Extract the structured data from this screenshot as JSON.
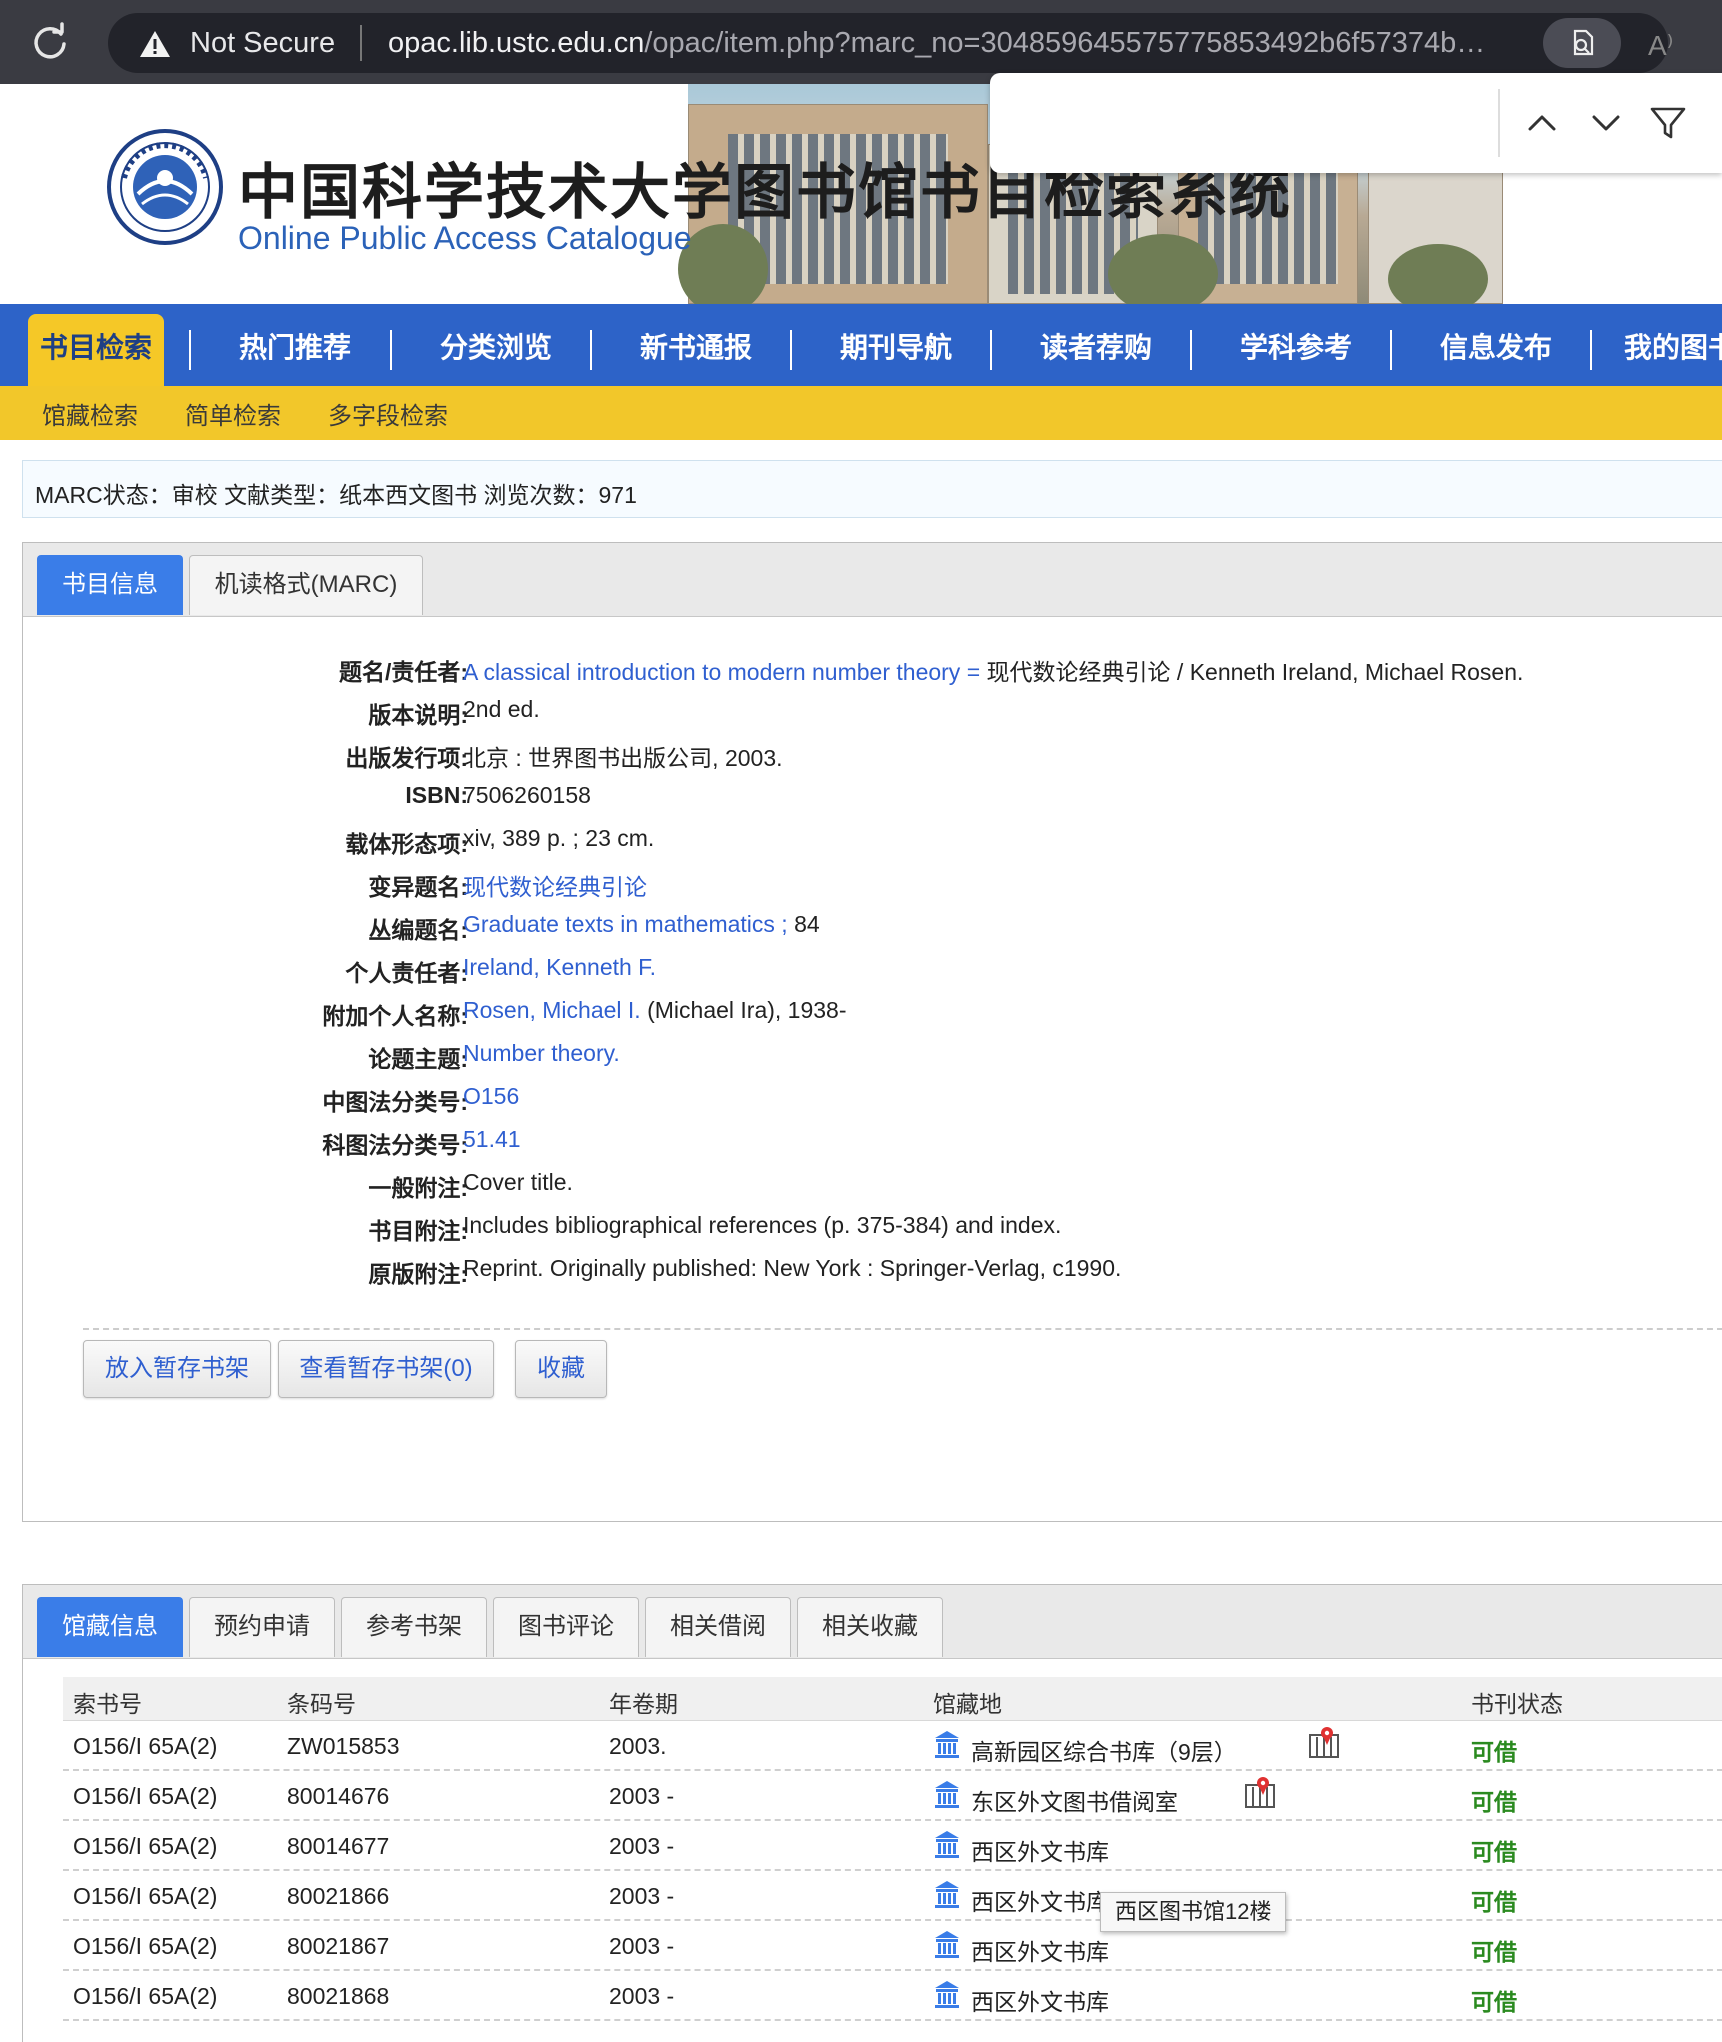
{
  "browser": {
    "security_label": "Not Secure",
    "url_domain": "opac.lib.ustc.edu.cn",
    "url_path": "/opac/item.php?marc_no=304859645575775853492b6f57374b…",
    "read_aloud": "A⁾"
  },
  "header": {
    "title": "中国科学技术大学图书馆书目检索系统",
    "subtitle": "Online Public Access Catalogue"
  },
  "nav": {
    "items": [
      "书目检索",
      "热门推荐",
      "分类浏览",
      "新书通报",
      "期刊导航",
      "读者荐购",
      "学科参考",
      "信息发布",
      "我的图书"
    ],
    "active_index": 0
  },
  "subnav": {
    "items": [
      "馆藏检索",
      "简单检索",
      "多字段检索"
    ]
  },
  "status_line": "MARC状态：审校  文献类型：纸本西文图书  浏览次数：971",
  "bib_tabs": [
    "书目信息",
    "机读格式(MARC)"
  ],
  "bib": {
    "title_label": "题名/责任者:",
    "title_link": "A classical introduction to modern number theory =",
    "title_rest": " 现代数论经典引论 / Kenneth Ireland, Michael Rosen.",
    "edition_label": "版本说明:",
    "edition": "2nd ed.",
    "publisher_label": "出版发行项:",
    "publisher": "北京 : 世界图书出版公司, 2003.",
    "isbn_label": "ISBN:",
    "isbn": "7506260158",
    "physical_label": "载体形态项:",
    "physical": "xiv, 389 p. ; 23 cm.",
    "variant_label": "变异题名:",
    "variant": "现代数论经典引论",
    "series_label": "丛编题名:",
    "series_link": "Graduate texts in mathematics ;",
    "series_rest": " 84",
    "author_label": "个人责任者:",
    "author": "Ireland, Kenneth F.",
    "added_author_label": "附加个人名称:",
    "added_author_link": "Rosen, Michael I.",
    "added_author_rest": " (Michael Ira), 1938-",
    "subject_label": "论题主题:",
    "subject": "Number theory.",
    "clc_label": "中图法分类号:",
    "clc": "O156",
    "sci_label": "科图法分类号:",
    "sci": "51.41",
    "note_label": "一般附注:",
    "note": "Cover title.",
    "bibnote_label": "书目附注:",
    "bibnote": "Includes bibliographical references (p. 375-384) and index.",
    "orig_label": "原版附注:",
    "orig": "Reprint. Originally published: New York : Springer-Verlag, c1990."
  },
  "actions": {
    "add_shelf": "放入暂存书架",
    "view_shelf": "查看暂存书架(0)",
    "favorite": "收藏"
  },
  "holding_tabs": [
    "馆藏信息",
    "预约申请",
    "参考书架",
    "图书评论",
    "相关借阅",
    "相关收藏"
  ],
  "holdings": {
    "headers": [
      "索书号",
      "条码号",
      "年卷期",
      "馆藏地",
      "书刊状态"
    ],
    "rows": [
      {
        "call_no": "O156/I 65A(2)",
        "barcode": "ZW015853",
        "year": "2003.",
        "location": "高新园区综合书库（9层）",
        "status": "可借"
      },
      {
        "call_no": "O156/I 65A(2)",
        "barcode": "80014676",
        "year": "2003 -",
        "location": "东区外文图书借阅室",
        "status": "可借"
      },
      {
        "call_no": "O156/I 65A(2)",
        "barcode": "80014677",
        "year": "2003 -",
        "location": "西区外文书库",
        "status": "可借"
      },
      {
        "call_no": "O156/I 65A(2)",
        "barcode": "80021866",
        "year": "2003 -",
        "location": "西区外文书库",
        "status": "可借"
      },
      {
        "call_no": "O156/I 65A(2)",
        "barcode": "80021867",
        "year": "2003 -",
        "location": "西区外文书库",
        "status": "可借"
      },
      {
        "call_no": "O156/I 65A(2)",
        "barcode": "80021868",
        "year": "2003 -",
        "location": "西区外文书库",
        "status": "可借"
      }
    ],
    "tooltip": "西区图书馆12楼"
  },
  "colors": {
    "nav_blue": "#2d63c8",
    "nav_yellow": "#f2c72a",
    "link_blue": "#2f5fd0",
    "status_green": "#2a8a1f"
  }
}
